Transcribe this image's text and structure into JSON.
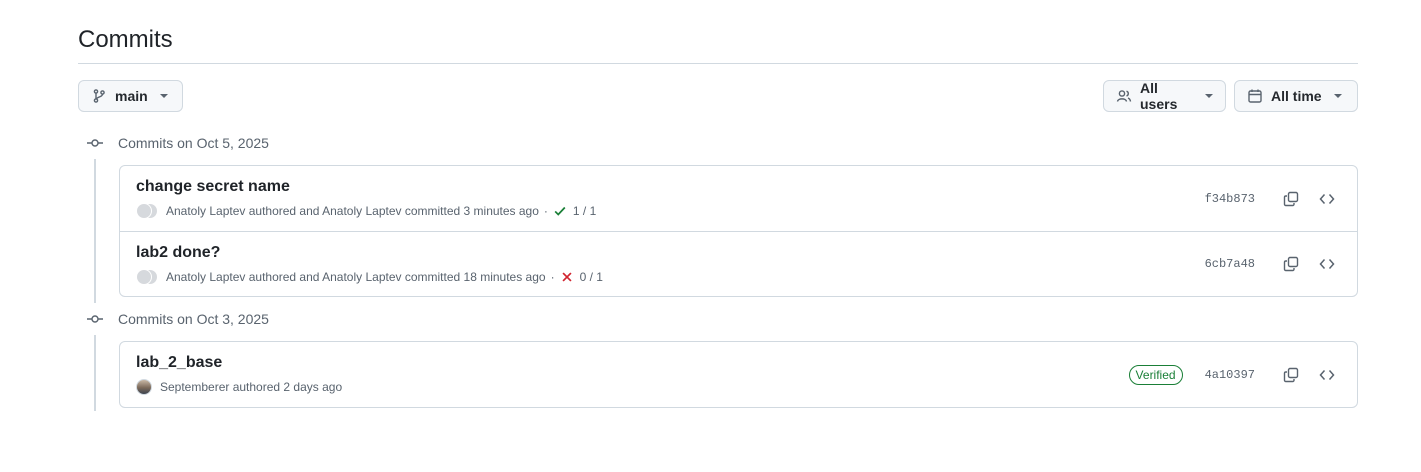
{
  "header": {
    "title": "Commits"
  },
  "filters": {
    "branch_label": "main",
    "users_label": "All users",
    "time_label": "All time"
  },
  "groups": [
    {
      "heading": "Commits on Oct 5, 2025",
      "commits": [
        {
          "message": "change secret name",
          "meta": "Anatoly Laptev authored and Anatoly Laptev committed 3 minutes ago",
          "dot": "·",
          "status": "success",
          "status_text": "1 / 1",
          "sha": "f34b873"
        },
        {
          "message": "lab2 done?",
          "meta": "Anatoly Laptev authored and Anatoly Laptev committed 18 minutes ago",
          "dot": "·",
          "status": "failure",
          "status_text": "0 / 1",
          "sha": "6cb7a48"
        }
      ]
    },
    {
      "heading": "Commits on Oct 3, 2025",
      "commits": [
        {
          "message": "lab_2_base",
          "meta": "Septemberer authored 2 days ago",
          "badge": "Verified",
          "sha": "4a10397"
        }
      ]
    }
  ],
  "colors": {
    "success": "#1a7f37",
    "failure": "#d1242f",
    "border": "#d1d9e0",
    "muted": "#59636e"
  },
  "icons": [
    "git-branch-icon",
    "people-icon",
    "calendar-icon",
    "git-commit-icon",
    "check-icon",
    "x-icon",
    "copy-icon",
    "code-icon"
  ]
}
